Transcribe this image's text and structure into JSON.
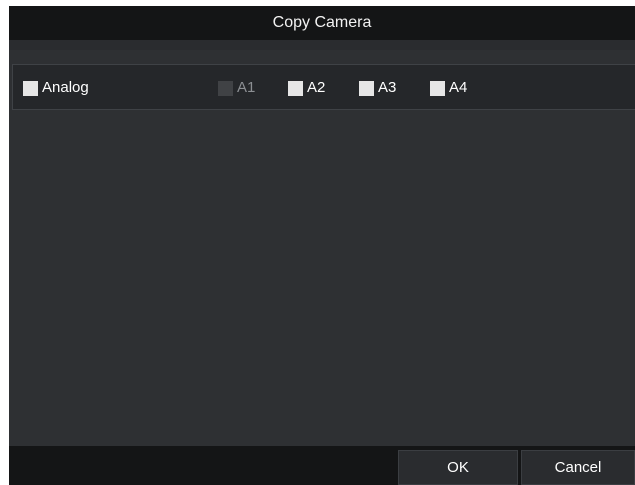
{
  "dialog": {
    "title": "Copy Camera"
  },
  "analog_row": {
    "group_label": "Analog",
    "group_checked": false,
    "channels": [
      {
        "label": "A1",
        "checked": false,
        "enabled": false
      },
      {
        "label": "A2",
        "checked": false,
        "enabled": true
      },
      {
        "label": "A3",
        "checked": false,
        "enabled": true
      },
      {
        "label": "A4",
        "checked": false,
        "enabled": true
      }
    ]
  },
  "buttons": {
    "ok": "OK",
    "cancel": "Cancel"
  },
  "colors": {
    "titlebar_bg": "#141516",
    "dialog_bg": "#2e3033",
    "row_bg": "#25272a",
    "checkbox": "#e6e6e6",
    "checkbox_disabled": "#404245",
    "text": "#ffffff",
    "text_disabled": "#8c8f93"
  }
}
